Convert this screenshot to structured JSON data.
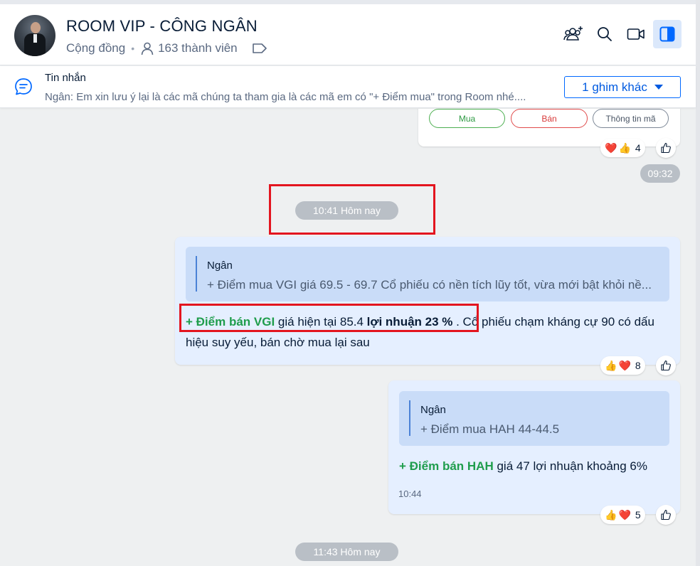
{
  "header": {
    "title": "ROOM VIP - CÔNG NGÂN",
    "type": "Cộng đồng",
    "members": "163 thành viên"
  },
  "pinned": {
    "label": "Tin nhắn",
    "text": "Ngân: Em xin lưu ý lại là các mã chúng ta tham gia là các mã em có \"+ Điểm mua\" trong Room nhé....",
    "more_button": "1 ghim khác"
  },
  "prev_card": {
    "buttons": [
      "Mua",
      "Bán",
      "Thông tin mã"
    ],
    "reaction_count": "4",
    "time": "09:32"
  },
  "divider1": "10:41 Hôm nay",
  "message1": {
    "quote_name": "Ngân",
    "quote_text": "+ Điểm mua VGI giá 69.5 - 69.7 Cổ phiếu có nền tích lũy tốt, vừa mới bật khỏi nề...",
    "sell_label": "+ Điểm bán VGI",
    "price_text": " giá hiện tại 85.4 ",
    "profit_text": "lợi nhuận 23 %",
    "rest_text": " . Cổ phiếu chạm kháng cự 90 có dấu hiệu suy yếu, bán chờ mua lại sau",
    "reaction_count": "8"
  },
  "message2": {
    "quote_name": "Ngân",
    "quote_text": "+ Điểm mua HAH 44-44.5",
    "sell_label": "+ Điểm bán HAH",
    "rest_text": " giá 47 lợi nhuận khoảng 6%",
    "time": "10:44",
    "reaction_count": "5"
  },
  "divider2": "11:43 Hôm nay",
  "colors": {
    "accent": "#0068ff",
    "highlight": "#e3151f",
    "green": "#1f9d4c",
    "bubble": "#e5efff"
  }
}
